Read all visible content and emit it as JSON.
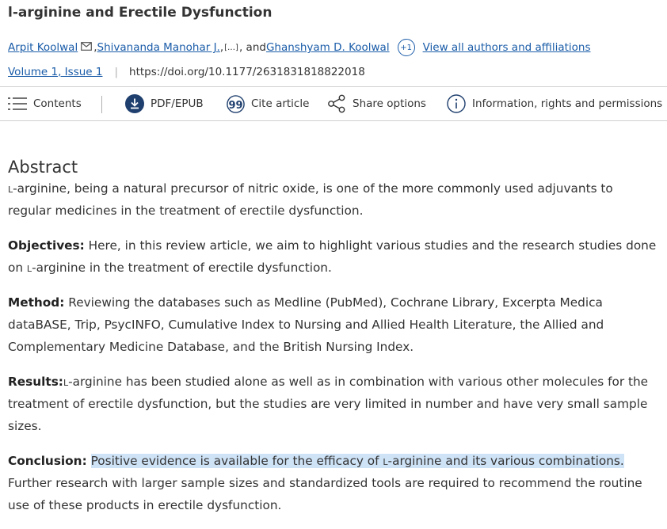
{
  "article": {
    "title": "l-arginine and Erectile Dysfunction",
    "authors": [
      "Arpit Koolwal",
      "Shivananda Manohar J.",
      "Ghanshyam D. Koolwal"
    ],
    "author_sep": ", ",
    "ellipsis": "[…]",
    "and_text": ", and ",
    "more_authors_badge": "+1",
    "view_all_link": "View all authors and affiliations",
    "volume_issue": "Volume 1, Issue 1",
    "doi": "https://doi.org/10.1177/2631831818822018"
  },
  "toolbar": {
    "contents": "Contents",
    "pdf": "PDF/EPUB",
    "cite": "Cite article",
    "share": "Share options",
    "info": "Information, rights and permissions"
  },
  "abstract": {
    "heading": "Abstract",
    "l_prefix": "l",
    "intro_rest": "-arginine, being a natural precursor of nitric oxide, is one of the more commonly used adjuvants to regular medicines in the treatment of erectile dysfunction.",
    "objectives_label": "Objectives:",
    "objectives_text": " Here, in this review article, we aim to highlight various studies and the research studies done on ",
    "objectives_tail": "-arginine in the treatment of erectile dysfunction.",
    "method_label": "Method:",
    "method_text": " Reviewing the databases such as Medline (PubMed), Cochrane Library, Excerpta Medica dataBASE, Trip, PsycINFO, Cumulative Index to Nursing and Allied Health Literature, the Allied and Complementary Medicine Database, and the British Nursing Index.",
    "results_label": "Results:",
    "results_text": "-arginine has been studied alone as well as in combination with various other molecules for the treatment of erectile dysfunction, but the studies are very limited in number and have very small sample sizes.",
    "conclusion_label": "Conclusion:",
    "conclusion_hl_a": "Positive evidence is available for the efficacy of ",
    "conclusion_hl_b": "-arginine and its various combinations.",
    "conclusion_rest": " Further research with larger sample sizes and standardized tools are required to recommend the routine use of these products in erectile dysfunction."
  },
  "colors": {
    "link": "#1a5ca8",
    "highlight": "#cfe3f7",
    "text": "#333333"
  },
  "icons": [
    "mail-icon",
    "menu-icon",
    "download-icon",
    "quote-icon",
    "share-icon",
    "info-icon"
  ]
}
